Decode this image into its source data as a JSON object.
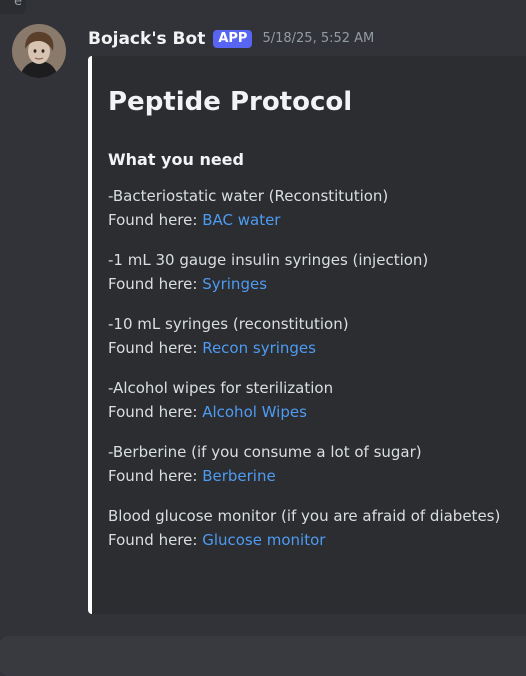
{
  "top_stub": {
    "text": "e"
  },
  "message": {
    "author": "Bojack's Bot",
    "badge": "APP",
    "timestamp": "5/18/25, 5:52 AM"
  },
  "embed": {
    "title": "Peptide Protocol",
    "subtitle": "What you need",
    "items": [
      {
        "item": "-Bacteriostatic water (Reconstitution)",
        "prefix": "Found here: ",
        "link": "BAC water"
      },
      {
        "item": "-1 mL 30 gauge insulin syringes (injection)",
        "prefix": "Found here: ",
        "link": "Syringes"
      },
      {
        "item": "-10 mL syringes (reconstitution)",
        "prefix": "Found here: ",
        "link": "Recon syringes"
      },
      {
        "item": "-Alcohol wipes for sterilization",
        "prefix": "Found here: ",
        "link": "Alcohol Wipes"
      },
      {
        "item": "-Berberine (if you consume a lot of sugar)",
        "prefix": "Found here: ",
        "link": "Berberine"
      },
      {
        "item": "Blood glucose monitor (if you are afraid of diabetes)",
        "prefix": "Found here: ",
        "link": "Glucose monitor"
      }
    ]
  },
  "colors": {
    "background": "#313338",
    "embed_background": "#2b2d31",
    "embed_accent": "#ffffff",
    "link": "#4e9bf2",
    "badge": "#5865f2",
    "timestamp": "#949ba4"
  }
}
